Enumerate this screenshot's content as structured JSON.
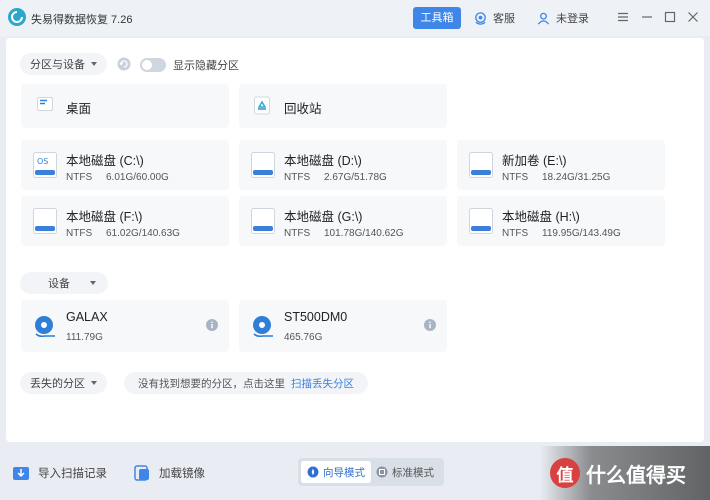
{
  "app": {
    "title": "失易得数据恢复 7.26"
  },
  "titlebar": {
    "toolbox_label": "工具箱",
    "support_label": "客服",
    "login_label": "未登录"
  },
  "section_partitions": {
    "label": "分区与设备"
  },
  "hidden_toggle": {
    "label": "显示隐藏分区",
    "state": "off"
  },
  "quick_items": [
    {
      "label": "桌面",
      "icon": "desktop-icon"
    },
    {
      "label": "回收站",
      "icon": "recycle-bin-icon"
    }
  ],
  "drives": [
    {
      "name": "本地磁盘 (C:\\)",
      "fs": "NTFS",
      "size": "6.01G/60.00G",
      "icon": "os-drive-icon"
    },
    {
      "name": "本地磁盘 (D:\\)",
      "fs": "NTFS",
      "size": "2.67G/51.78G",
      "icon": "drive-icon"
    },
    {
      "name": "新加卷 (E:\\)",
      "fs": "NTFS",
      "size": "18.24G/31.25G",
      "icon": "drive-icon"
    },
    {
      "name": "本地磁盘 (F:\\)",
      "fs": "NTFS",
      "size": "61.02G/140.63G",
      "icon": "drive-icon"
    },
    {
      "name": "本地磁盘 (G:\\)",
      "fs": "NTFS",
      "size": "101.78G/140.62G",
      "icon": "drive-icon"
    },
    {
      "name": "本地磁盘 (H:\\)",
      "fs": "NTFS",
      "size": "119.95G/143.49G",
      "icon": "drive-icon"
    }
  ],
  "section_devices": {
    "label": "设备"
  },
  "devices": [
    {
      "name": "GALAX",
      "size": "111.79G",
      "icon": "disk-device-icon"
    },
    {
      "name": "ST500DM0",
      "size": "465.76G",
      "icon": "disk-device-icon"
    }
  ],
  "section_lost": {
    "label": "丢失的分区"
  },
  "lost_hint": {
    "text": "没有找到想要的分区，点击这里",
    "link": "扫描丢失分区"
  },
  "bottombar": {
    "import_label": "导入扫描记录",
    "mount_label": "加载镜像",
    "wizard_mode_label": "向导模式",
    "standard_mode_label": "标准模式"
  },
  "watermark": {
    "text": "什么值得买",
    "badge": "值"
  },
  "colors": {
    "accent": "#3f86e8",
    "drive_bar": "#3a7fd9",
    "background": "#e9edf3"
  }
}
